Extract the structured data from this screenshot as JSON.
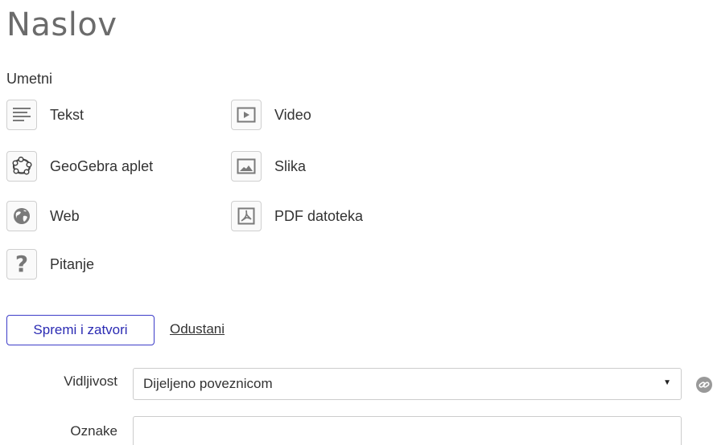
{
  "header": {
    "title": "Naslov"
  },
  "insert": {
    "label": "Umetni",
    "items": [
      {
        "label": "Tekst",
        "icon": "text-lines-icon"
      },
      {
        "label": "Video",
        "icon": "video-play-icon"
      },
      {
        "label": "GeoGebra aplet",
        "icon": "geogebra-icon"
      },
      {
        "label": "Slika",
        "icon": "image-icon"
      },
      {
        "label": "Web",
        "icon": "globe-icon"
      },
      {
        "label": "PDF datoteka",
        "icon": "pdf-icon"
      },
      {
        "label": "Pitanje",
        "icon": "question-icon"
      }
    ]
  },
  "actions": {
    "save_label": "Spremi i zatvori",
    "cancel_label": "Odustani"
  },
  "form": {
    "visibility": {
      "label": "Vidljivost",
      "value": "Dijeljeno poveznicom"
    },
    "tags": {
      "label": "Oznake",
      "value": ""
    }
  },
  "colors": {
    "accent": "#3c3cc8",
    "icon_border": "#cfcfcf",
    "icon_fill": "#7a7a7a"
  }
}
